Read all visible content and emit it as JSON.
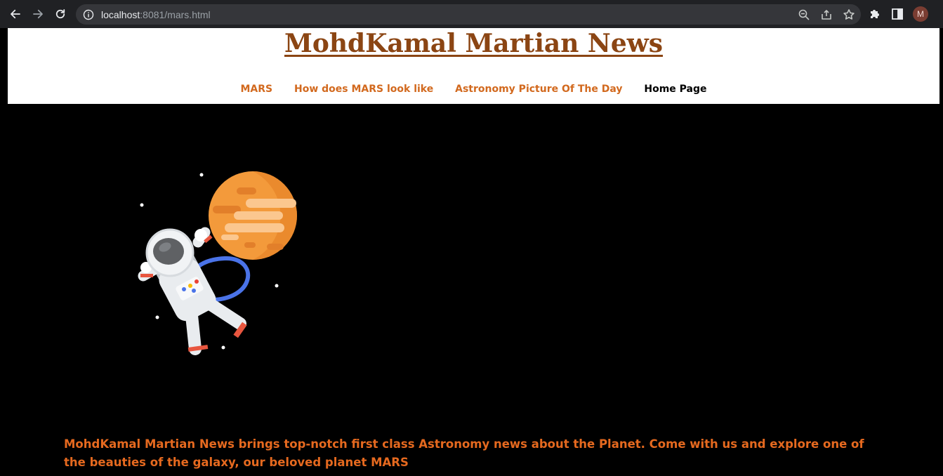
{
  "browser": {
    "url_host": "localhost",
    "url_rest": ":8081/mars.html",
    "profile_initial": "M"
  },
  "header": {
    "title": "MohdKamal Martian News",
    "title_color": "#8b4513",
    "nav": [
      {
        "label": "MARS"
      },
      {
        "label": "How does MARS look like"
      },
      {
        "label": "Astronomy Picture Of The Day"
      },
      {
        "label": "Home Page",
        "active": true
      }
    ],
    "nav_color": "#d2691e"
  },
  "main": {
    "intro": "MohdKamal Martian News brings top-notch first class Astronomy news about the Planet. Come with us and explore one of the beauties of the galaxy, our beloved planet MARS",
    "intro_color": "#e5691f"
  }
}
